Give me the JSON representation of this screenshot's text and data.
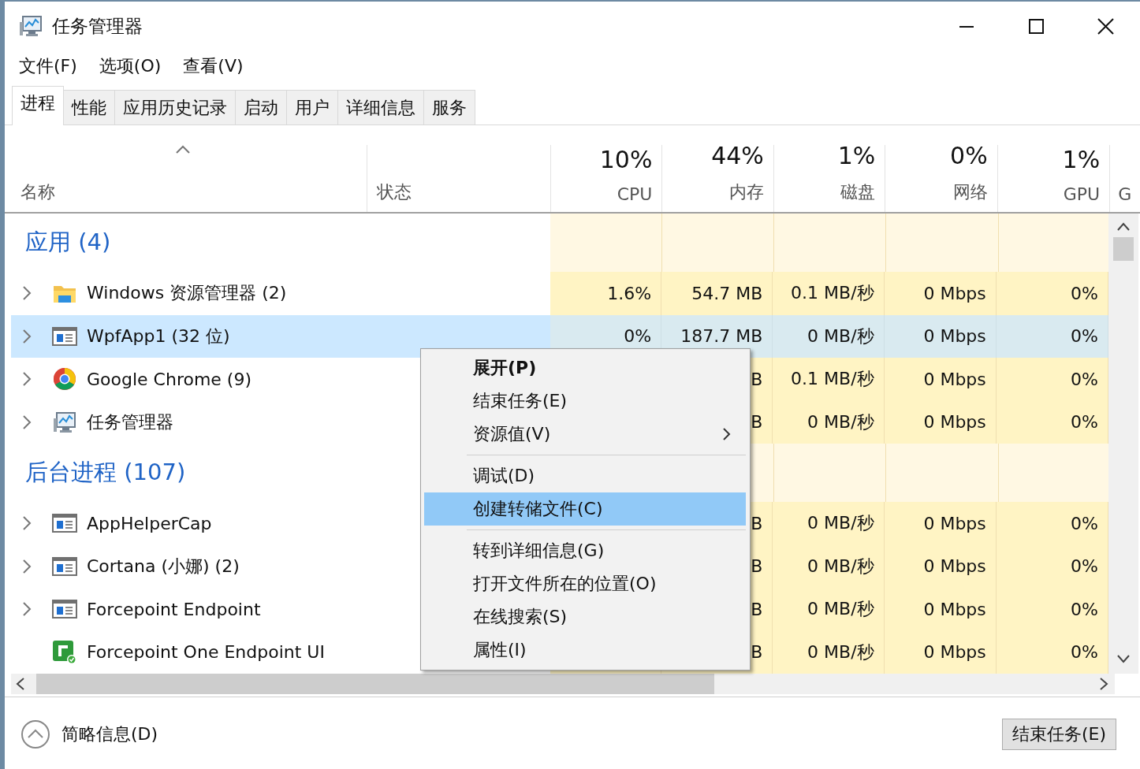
{
  "window": {
    "title": "任务管理器"
  },
  "menu_bar": [
    "文件(F)",
    "选项(O)",
    "查看(V)"
  ],
  "tabs": [
    {
      "label": "进程",
      "selected": true
    },
    {
      "label": "性能",
      "selected": false
    },
    {
      "label": "应用历史记录",
      "selected": false
    },
    {
      "label": "启动",
      "selected": false
    },
    {
      "label": "用户",
      "selected": false
    },
    {
      "label": "详细信息",
      "selected": false
    },
    {
      "label": "服务",
      "selected": false
    }
  ],
  "columns": [
    {
      "label": "名称"
    },
    {
      "label": "状态"
    },
    {
      "usage": "10%",
      "label": "CPU"
    },
    {
      "usage": "44%",
      "label": "内存"
    },
    {
      "usage": "1%",
      "label": "磁盘"
    },
    {
      "usage": "0%",
      "label": "网络"
    },
    {
      "usage": "1%",
      "label": "GPU"
    },
    {
      "label": "G"
    }
  ],
  "groups": [
    {
      "title": "应用 (4)",
      "rows": [
        {
          "name": "Windows 资源管理器 (2)",
          "expandable": true,
          "selected": false,
          "cpu": "1.6%",
          "memory": "54.7 MB",
          "disk": "0.1 MB/秒",
          "network": "0 Mbps",
          "gpu": "0%"
        },
        {
          "name": "WpfApp1 (32 位)",
          "expandable": true,
          "selected": true,
          "cpu": "0%",
          "memory": "187.7 MB",
          "disk": "0 MB/秒",
          "network": "0 Mbps",
          "gpu": "0%"
        },
        {
          "name": "Google Chrome (9)",
          "expandable": true,
          "selected": false,
          "memory": "B",
          "disk": "0.1 MB/秒",
          "network": "0 Mbps",
          "gpu": "0%"
        },
        {
          "name": "任务管理器",
          "expandable": true,
          "selected": false,
          "memory": "B",
          "disk": "0 MB/秒",
          "network": "0 Mbps",
          "gpu": "0%"
        }
      ]
    },
    {
      "title": "后台进程 (107)",
      "rows": [
        {
          "name": "AppHelperCap",
          "expandable": true,
          "selected": false,
          "memory": "B",
          "disk": "0 MB/秒",
          "network": "0 Mbps",
          "gpu": "0%"
        },
        {
          "name": "Cortana (小娜) (2)",
          "expandable": true,
          "selected": false,
          "memory": "B",
          "disk": "0 MB/秒",
          "network": "0 Mbps",
          "gpu": "0%"
        },
        {
          "name": "Forcepoint Endpoint",
          "expandable": true,
          "selected": false,
          "memory": "B",
          "disk": "0 MB/秒",
          "network": "0 Mbps",
          "gpu": "0%"
        },
        {
          "name": "Forcepoint One Endpoint UI",
          "expandable": false,
          "selected": false,
          "memory": "B",
          "disk": "0 MB/秒",
          "network": "0 Mbps",
          "gpu": "0%"
        }
      ]
    }
  ],
  "context_menu": {
    "items": [
      {
        "kind": "item",
        "label": "展开(P)",
        "bold": true,
        "submenu": false,
        "selected": false
      },
      {
        "kind": "item",
        "label": "结束任务(E)",
        "bold": false,
        "submenu": false,
        "selected": false
      },
      {
        "kind": "item",
        "label": "资源值(V)",
        "bold": false,
        "submenu": true,
        "selected": false
      },
      {
        "kind": "separator"
      },
      {
        "kind": "item",
        "label": "调试(D)",
        "bold": false,
        "submenu": false,
        "selected": false
      },
      {
        "kind": "item",
        "label": "创建转储文件(C)",
        "bold": false,
        "submenu": false,
        "selected": true
      },
      {
        "kind": "separator"
      },
      {
        "kind": "item",
        "label": "转到详细信息(G)",
        "bold": false,
        "submenu": false,
        "selected": false
      },
      {
        "kind": "item",
        "label": "打开文件所在的位置(O)",
        "bold": false,
        "submenu": false,
        "selected": false
      },
      {
        "kind": "item",
        "label": "在线搜索(S)",
        "bold": false,
        "submenu": false,
        "selected": false
      },
      {
        "kind": "item",
        "label": "属性(I)",
        "bold": false,
        "submenu": false,
        "selected": false
      }
    ]
  },
  "footer": {
    "details_toggle": "简略信息(D)",
    "end_task_button": "结束任务(E)"
  }
}
